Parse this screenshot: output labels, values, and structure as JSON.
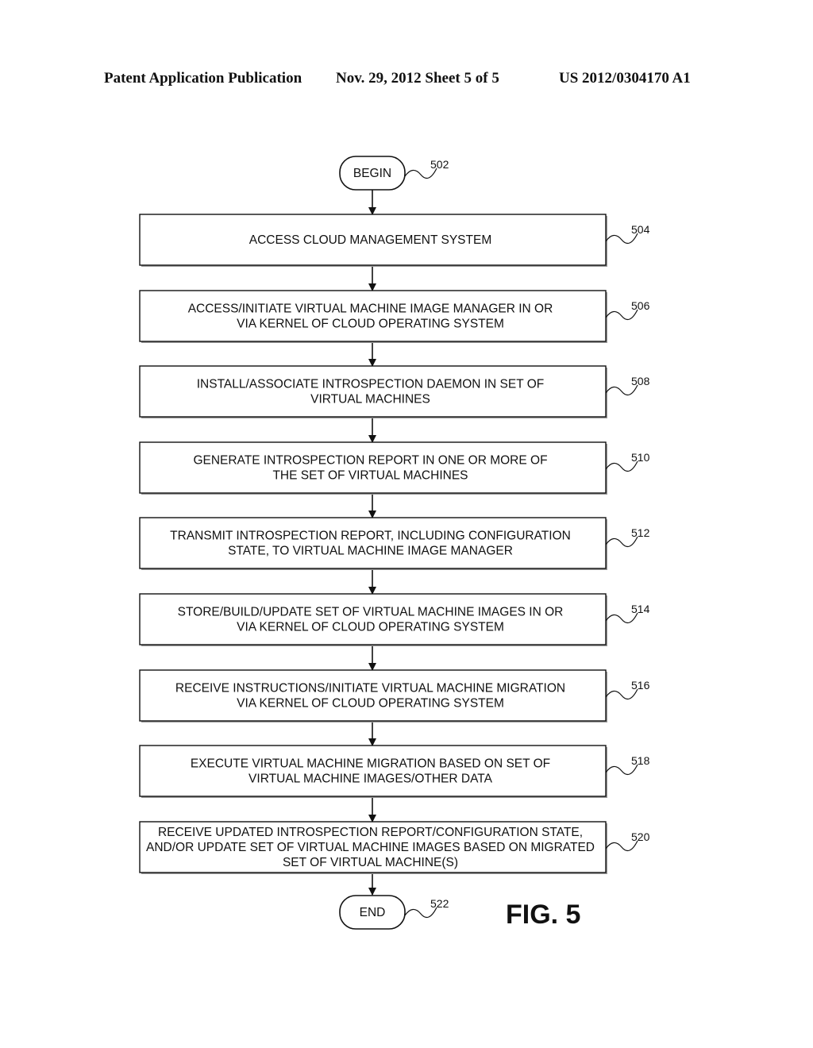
{
  "header": {
    "publication": "Patent Application Publication",
    "date_sheet": "Nov. 29, 2012   Sheet 5 of 5",
    "patent_number": "US 2012/0304170 A1"
  },
  "flowchart": {
    "begin": {
      "label": "BEGIN",
      "ref": "502"
    },
    "steps": [
      {
        "ref": "504",
        "lines": [
          "ACCESS CLOUD MANAGEMENT SYSTEM"
        ]
      },
      {
        "ref": "506",
        "lines": [
          "ACCESS/INITIATE VIRTUAL MACHINE IMAGE MANAGER IN OR",
          "VIA KERNEL OF CLOUD OPERATING SYSTEM"
        ]
      },
      {
        "ref": "508",
        "lines": [
          "INSTALL/ASSOCIATE INTROSPECTION DAEMON IN SET OF",
          "VIRTUAL MACHINES"
        ]
      },
      {
        "ref": "510",
        "lines": [
          "GENERATE INTROSPECTION REPORT IN ONE OR MORE OF",
          "THE SET OF VIRTUAL MACHINES"
        ]
      },
      {
        "ref": "512",
        "lines": [
          "TRANSMIT INTROSPECTION REPORT, INCLUDING CONFIGURATION",
          "STATE, TO VIRTUAL MACHINE IMAGE MANAGER"
        ]
      },
      {
        "ref": "514",
        "lines": [
          "STORE/BUILD/UPDATE SET OF VIRTUAL MACHINE IMAGES IN OR",
          "VIA KERNEL OF CLOUD OPERATING SYSTEM"
        ]
      },
      {
        "ref": "516",
        "lines": [
          "RECEIVE INSTRUCTIONS/INITIATE VIRTUAL MACHINE MIGRATION",
          "VIA KERNEL OF CLOUD OPERATING SYSTEM"
        ]
      },
      {
        "ref": "518",
        "lines": [
          "EXECUTE VIRTUAL MACHINE MIGRATION BASED ON SET OF",
          "VIRTUAL MACHINE IMAGES/OTHER DATA"
        ]
      },
      {
        "ref": "520",
        "lines": [
          "RECEIVE UPDATED INTROSPECTION REPORT/CONFIGURATION STATE,",
          "AND/OR UPDATE SET OF VIRTUAL MACHINE IMAGES BASED ON MIGRATED",
          "SET OF VIRTUAL MACHINE(S)"
        ]
      }
    ],
    "end": {
      "label": "END",
      "ref": "522"
    }
  },
  "figure_label": "FIG. 5"
}
